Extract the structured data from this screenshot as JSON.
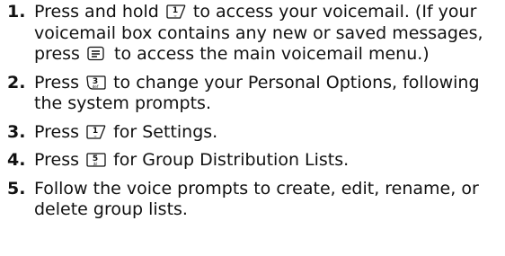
{
  "steps": [
    {
      "number": "1.",
      "parts": [
        {
          "type": "text",
          "text": "Press and hold "
        },
        {
          "type": "key",
          "key": "1"
        },
        {
          "type": "text",
          "text": " to access your voicemail. (If your voicemail box contains any new or saved messages, press "
        },
        {
          "type": "key",
          "key": "menu"
        },
        {
          "type": "text",
          "text": " to access the main voicemail menu.)"
        }
      ]
    },
    {
      "number": "2.",
      "parts": [
        {
          "type": "text",
          "text": "Press "
        },
        {
          "type": "key",
          "key": "3"
        },
        {
          "type": "text",
          "text": " to change your Personal Options, following the system prompts."
        }
      ]
    },
    {
      "number": "3.",
      "parts": [
        {
          "type": "text",
          "text": "Press "
        },
        {
          "type": "key",
          "key": "1"
        },
        {
          "type": "text",
          "text": " for Settings."
        }
      ]
    },
    {
      "number": "4.",
      "parts": [
        {
          "type": "text",
          "text": "Press "
        },
        {
          "type": "key",
          "key": "5"
        },
        {
          "type": "text",
          "text": " for Group Distribution Lists."
        }
      ]
    },
    {
      "number": "5.",
      "parts": [
        {
          "type": "text",
          "text": "Follow the voice prompts to create, edit, rename, or delete group lists."
        }
      ]
    }
  ],
  "keys": {
    "1": {
      "icon": "key-1-icon",
      "label": "1",
      "sub": "∞"
    },
    "3": {
      "icon": "key-3-icon",
      "label": "3",
      "sub": "def"
    },
    "5": {
      "icon": "key-5-icon",
      "label": "5",
      "sub": "jkl"
    },
    "menu": {
      "icon": "menu-key-icon",
      "label": "",
      "sub": ""
    }
  }
}
